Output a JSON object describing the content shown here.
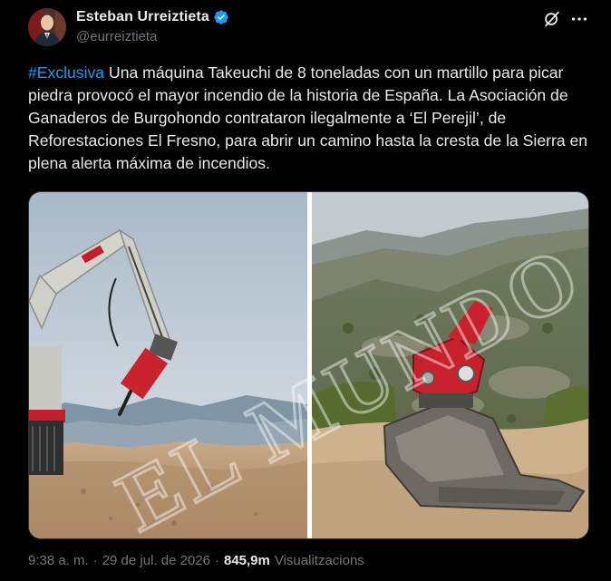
{
  "author": {
    "display_name": "Esteban Urreiztieta",
    "handle": "@eurreiztieta",
    "verified": true
  },
  "tweet": {
    "hashtag": "#Exclusiva",
    "text": " Una máquina Takeuchi de 8 toneladas con un martillo para picar piedra provocó el mayor incendio de la historia de España. La Asociación de Ganaderos de Burgohondo contrataron ilegalmente a ‘El Perejil’, de Reforestaciones El Fresno, para abrir un camino hasta la cresta de la Sierra en plena alerta máxima de incendios."
  },
  "media": {
    "photo_count": 2,
    "watermark_text": "EL MUNDO"
  },
  "meta": {
    "time": "9:38 a. m.",
    "separator1": "·",
    "date": "29 de jul. de 2026",
    "separator2": "·",
    "views_count": "845,9m",
    "views_label": "Visualitzacions"
  },
  "icons": {
    "verified": "verified-badge-icon",
    "grok": "grok-icon",
    "more": "more-options-icon"
  },
  "colors": {
    "background": "#000000",
    "text_primary": "#e7e9ea",
    "text_secondary": "#71767b",
    "accent": "#1d9bf0"
  }
}
